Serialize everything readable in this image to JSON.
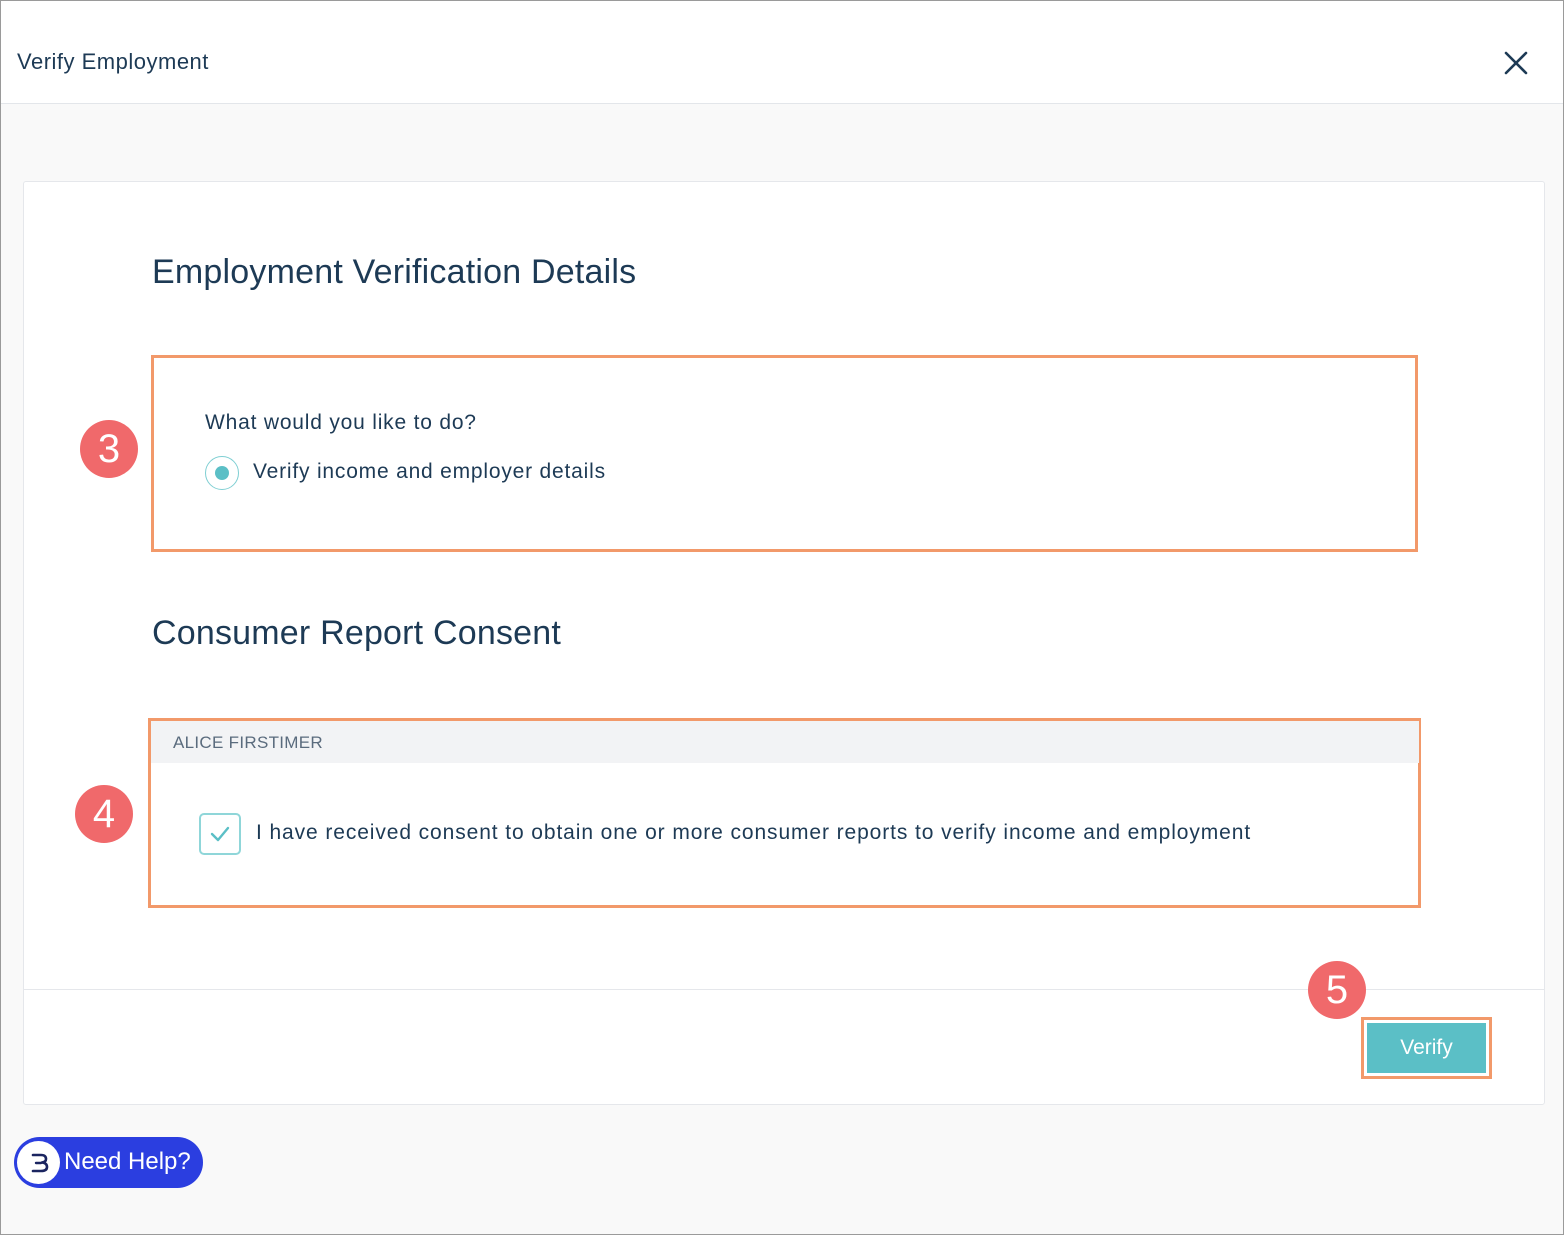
{
  "header": {
    "title": "Verify Employment",
    "close_icon": "close-icon"
  },
  "employment_section": {
    "title": "Employment Verification Details",
    "question": "What would you like to do?",
    "option_label": "Verify income and employer details",
    "option_selected": true
  },
  "consent_section": {
    "title": "Consumer Report Consent",
    "borrower_name": "ALICE FIRSTIMER",
    "consent_text": "I have received consent to obtain one or more consumer reports to verify income and employment",
    "consent_checked": true
  },
  "steps": [
    "3",
    "4",
    "5"
  ],
  "footer": {
    "verify_label": "Verify"
  },
  "help_widget": {
    "label": "Need Help?"
  },
  "colors": {
    "accent": "#5bbfc6",
    "highlight": "#f2996a",
    "step_badge": "#f0696b",
    "help_button": "#2b3ee0",
    "text": "#1d3a55"
  }
}
